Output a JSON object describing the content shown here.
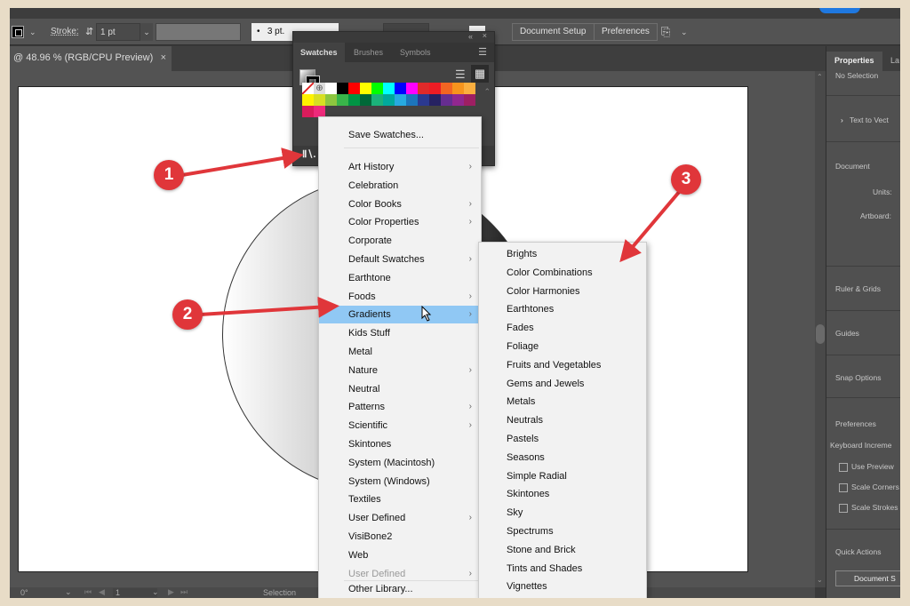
{
  "control_bar": {
    "stroke_label": "Stroke:",
    "stroke_value": "1 pt",
    "brush_value": "3 pt.",
    "document_setup_label": "Document Setup",
    "preferences_label": "Preferences"
  },
  "document_tab": {
    "title": "@ 48.96 % (RGB/CPU Preview)",
    "close": "×"
  },
  "swatches_panel": {
    "tabs": [
      "Swatches",
      "Brushes",
      "Symbols"
    ],
    "active_tab": "Swatches",
    "collapse_icon": "«",
    "close_icon": "×",
    "swatch_colors": [
      [
        "none",
        "reg",
        "#ffffff",
        "#000000",
        "#ff0000",
        "#ffff00",
        "#00ff00",
        "#00ffff",
        "#0000ff",
        "#ff00ff",
        "#e02a2a",
        "#ed1c24",
        "#f26522",
        "#f7941d",
        "#fbaf3f"
      ],
      [
        "#fff200",
        "#d7df23",
        "#8dc63f",
        "#39b54a",
        "#009444",
        "#006838",
        "#1bb27a",
        "#00a99d",
        "#27aae1",
        "#1c75bc",
        "#2b3990",
        "#262262",
        "#662d91",
        "#92278f",
        "#9e1f63"
      ],
      [
        "#da1c5c",
        "#ee2a7b"
      ]
    ]
  },
  "library_menu": {
    "header_item": "Save Swatches...",
    "items": [
      {
        "label": "Art History",
        "submenu": true
      },
      {
        "label": "Celebration",
        "submenu": false
      },
      {
        "label": "Color Books",
        "submenu": true
      },
      {
        "label": "Color Properties",
        "submenu": true
      },
      {
        "label": "Corporate",
        "submenu": false
      },
      {
        "label": "Default Swatches",
        "submenu": true
      },
      {
        "label": "Earthtone",
        "submenu": false
      },
      {
        "label": "Foods",
        "submenu": true
      },
      {
        "label": "Gradients",
        "submenu": true,
        "highlighted": true
      },
      {
        "label": "Kids Stuff",
        "submenu": false
      },
      {
        "label": "Metal",
        "submenu": false
      },
      {
        "label": "Nature",
        "submenu": true
      },
      {
        "label": "Neutral",
        "submenu": false
      },
      {
        "label": "Patterns",
        "submenu": true
      },
      {
        "label": "Scientific",
        "submenu": true
      },
      {
        "label": "Skintones",
        "submenu": false
      },
      {
        "label": "System (Macintosh)",
        "submenu": false
      },
      {
        "label": "System (Windows)",
        "submenu": false
      },
      {
        "label": "Textiles",
        "submenu": false
      },
      {
        "label": "User Defined",
        "submenu": true
      },
      {
        "label": "VisiBone2",
        "submenu": false
      },
      {
        "label": "Web",
        "submenu": false
      },
      {
        "label": "User Defined",
        "submenu": true,
        "disabled": true
      }
    ],
    "footer_item": "Other Library...",
    "arrow": "›"
  },
  "gradients_submenu": {
    "items": [
      "Brights",
      "Color Combinations",
      "Color Harmonies",
      "Earthtones",
      "Fades",
      "Foliage",
      "Fruits and Vegetables",
      "Gems and Jewels",
      "Metals",
      "Neutrals",
      "Pastels",
      "Seasons",
      "Simple Radial",
      "Skintones",
      "Sky",
      "Spectrums",
      "Stone and Brick",
      "Tints and Shades",
      "Vignettes"
    ]
  },
  "properties_panel": {
    "tabs": [
      "Properties",
      "La"
    ],
    "selection": "No Selection",
    "text_to_vector": "Text to Vect",
    "document_section": "Document",
    "units_label": "Units:",
    "artboard_label": "Artboard:",
    "ruler_grids": "Ruler & Grids",
    "guides": "Guides",
    "snap_options": "Snap Options",
    "preferences": "Preferences",
    "keyboard_increment": "Keyboard Increme",
    "checkboxes": [
      "Use Preview",
      "Scale Corners",
      "Scale Strokes"
    ],
    "quick_actions": "Quick Actions",
    "document_setup_btn": "Document S"
  },
  "status_bar": {
    "rotation": "0°",
    "artboard_number": "1",
    "tool": "Selection"
  },
  "annotations": {
    "badges": [
      "1",
      "2",
      "3"
    ],
    "color": "#e0363a"
  }
}
